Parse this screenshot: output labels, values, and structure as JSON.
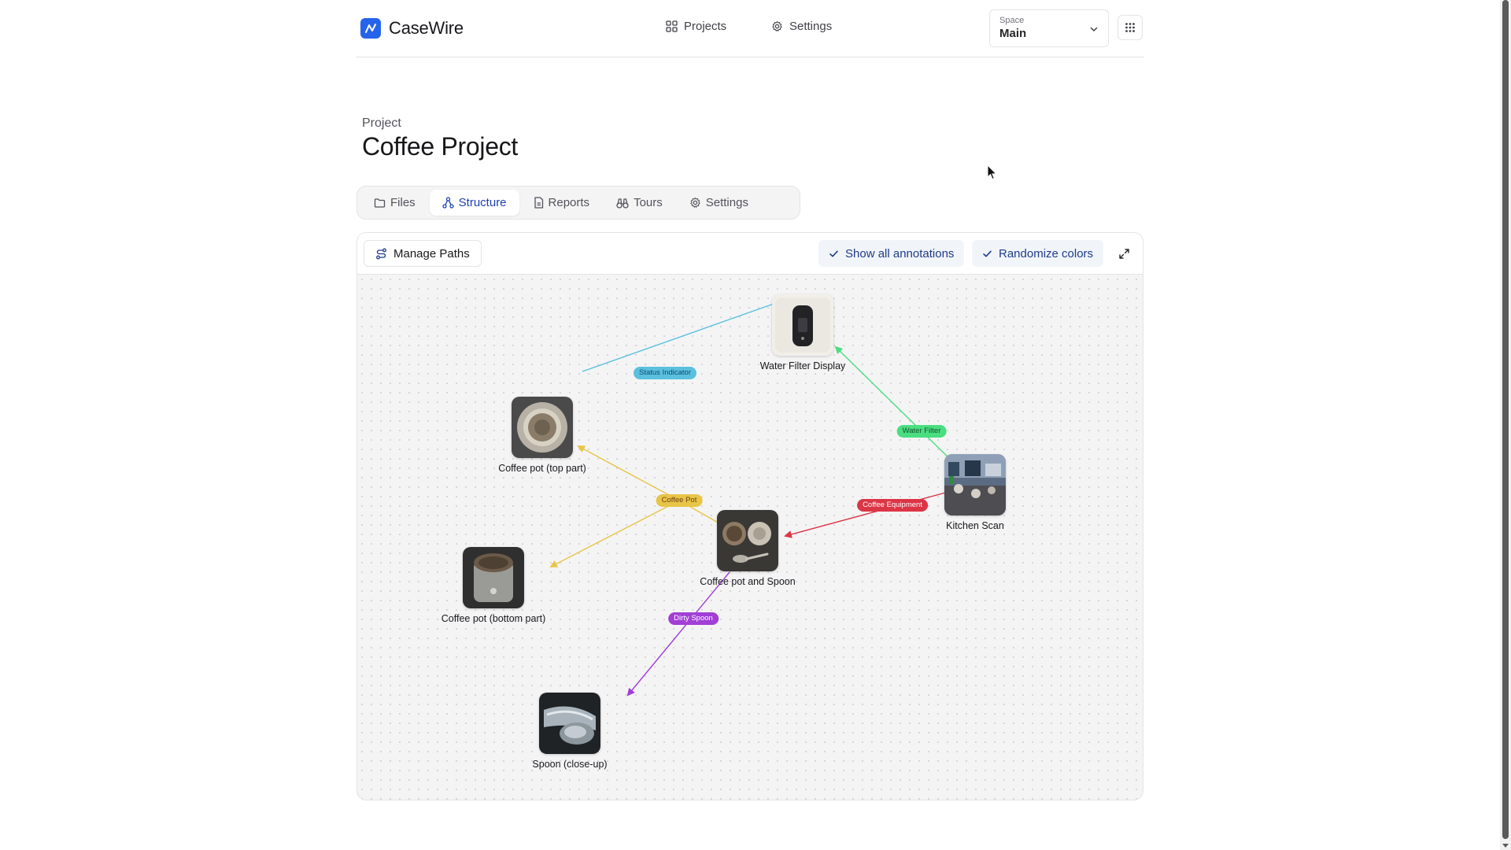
{
  "app": {
    "name": "CaseWire",
    "brand_color": "#2563eb"
  },
  "nav": {
    "projects_label": "Projects",
    "settings_label": "Settings"
  },
  "space": {
    "caption": "Space",
    "value": "Main"
  },
  "header": {
    "breadcrumb": "Project",
    "title": "Coffee Project"
  },
  "tabs": [
    {
      "label": "Files",
      "icon": "folder-icon",
      "active": false
    },
    {
      "label": "Structure",
      "icon": "structure-icon",
      "active": true
    },
    {
      "label": "Reports",
      "icon": "report-icon",
      "active": false
    },
    {
      "label": "Tours",
      "icon": "binoculars-icon",
      "active": false
    },
    {
      "label": "Settings",
      "icon": "gear-icon",
      "active": false
    }
  ],
  "toolbar": {
    "manage_paths_label": "Manage Paths",
    "show_annotations_label": "Show all annotations",
    "randomize_colors_label": "Randomize colors"
  },
  "graph": {
    "nodes": [
      {
        "id": "water_filter",
        "label": "Water Filter Display",
        "thumb": "dark-display"
      },
      {
        "id": "top_part",
        "label": "Coffee pot (top part)",
        "thumb": "metal-basket"
      },
      {
        "id": "bottom_part",
        "label": "Coffee pot (bottom part)",
        "thumb": "metal-canister"
      },
      {
        "id": "pot_spoon",
        "label": "Coffee pot and Spoon",
        "thumb": "pot-spoon"
      },
      {
        "id": "kitchen",
        "label": "Kitchen Scan",
        "thumb": "kitchen-scene"
      },
      {
        "id": "spoon",
        "label": "Spoon (close-up)",
        "thumb": "spoon"
      }
    ],
    "edges": [
      {
        "label": "Status Indicator",
        "color": "#5bc0de",
        "text_color": "#0c4a6e"
      },
      {
        "label": "Water Filter",
        "color": "#4ade80",
        "text_color": "#14532d"
      },
      {
        "label": "Coffee Pot",
        "color": "#e8c547",
        "text_color": "#713f12"
      },
      {
        "label": "Coffee Equipment",
        "color": "#dc3545",
        "text_color": "#ffffff"
      },
      {
        "label": "Dirty Spoon",
        "color": "#a13fd6",
        "text_color": "#ffffff"
      }
    ]
  }
}
